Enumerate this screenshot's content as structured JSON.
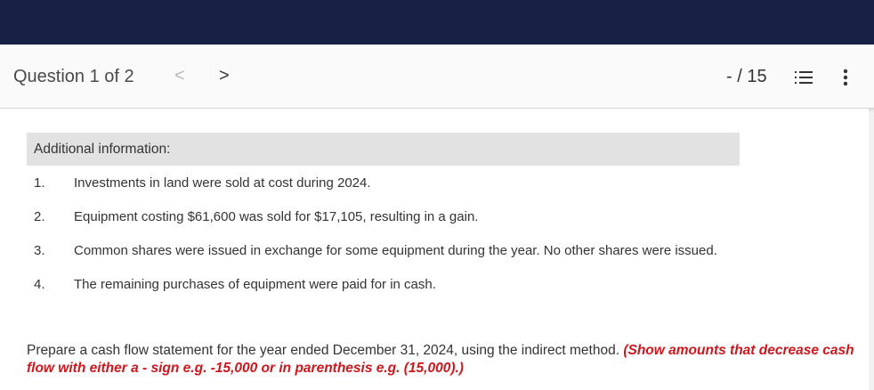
{
  "header": {
    "question_label": "Question 1 of 2",
    "prev_glyph": "<",
    "next_glyph": ">",
    "score": "- / 15",
    "list_icon": "list-icon",
    "more_icon": "more-vertical-icon"
  },
  "colors": {
    "topbar": "#172146",
    "hint": "#d0161c",
    "info_header_bg": "#e2e2e2"
  },
  "additional_info": {
    "title": "Additional information:",
    "items": [
      {
        "num": "1.",
        "text": "Investments in land were sold at cost during 2024."
      },
      {
        "num": "2.",
        "text": "Equipment costing $61,600 was sold for $17,105, resulting in a gain."
      },
      {
        "num": "3.",
        "text": "Common shares were issued in exchange for some equipment during the year. No other shares were issued."
      },
      {
        "num": "4.",
        "text": "The remaining purchases of equipment were paid for in cash."
      }
    ]
  },
  "prompt": {
    "text": "Prepare a cash flow statement for the year ended December 31, 2024, using the indirect method.",
    "hint": "(Show amounts that decrease cash flow with either a - sign e.g. -15,000 or in parenthesis e.g. (15,000).)"
  }
}
